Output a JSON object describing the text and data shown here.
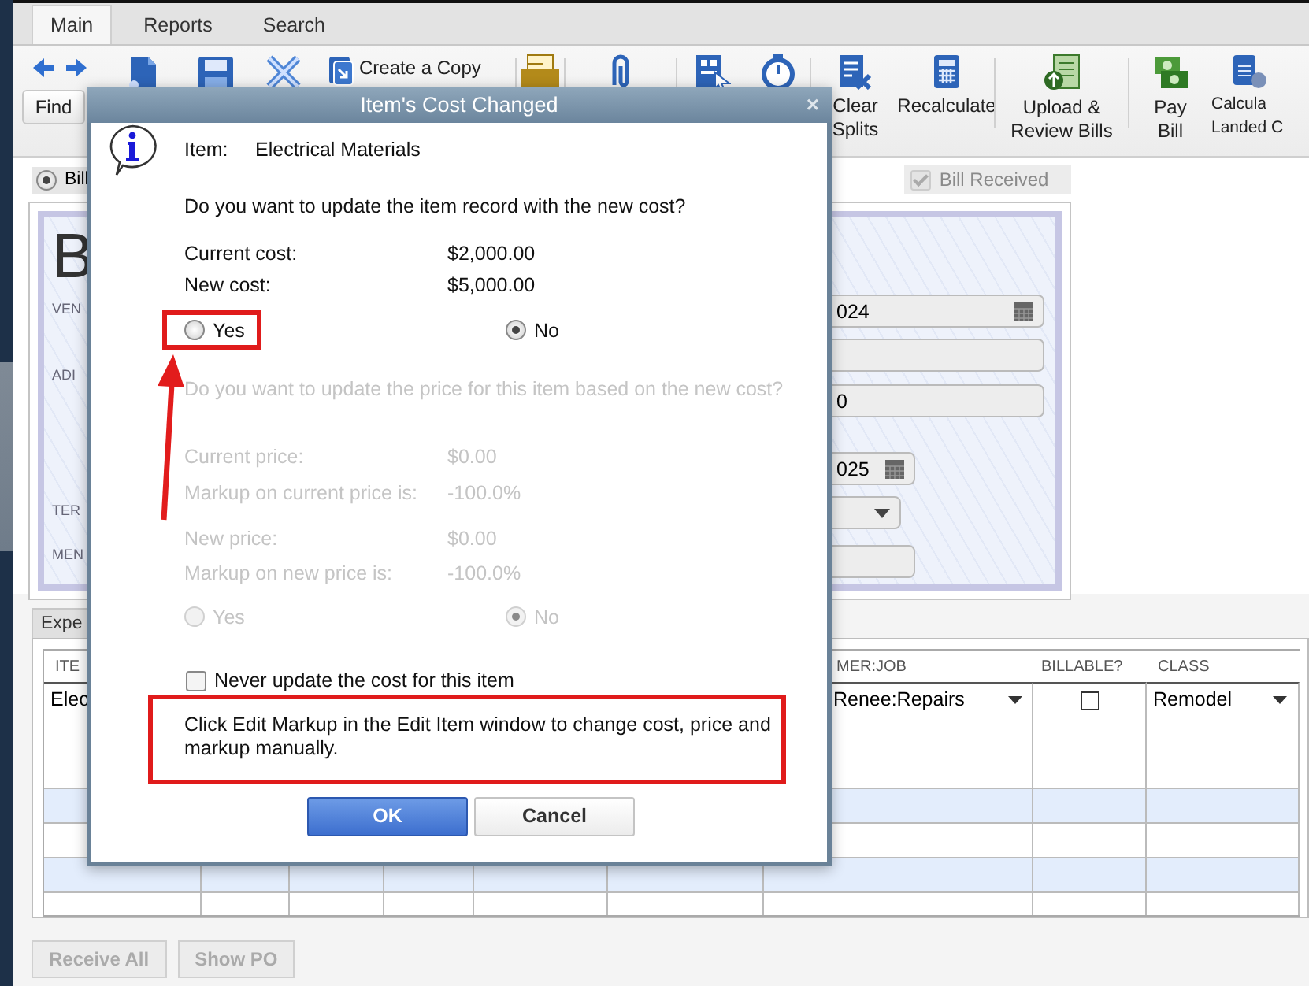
{
  "tabs": [
    {
      "label": "Main",
      "selected": true
    },
    {
      "label": "Reports",
      "selected": false
    },
    {
      "label": "Search",
      "selected": false
    }
  ],
  "toolbar": {
    "find": "Find",
    "create_copy": "Create a Copy",
    "buttons": [
      {
        "lines": [
          "Clear",
          "Splits"
        ]
      },
      {
        "lines": [
          "Recalculate"
        ]
      },
      {
        "lines": [
          "Upload &",
          "Review Bills"
        ]
      },
      {
        "lines": [
          "Pay",
          "Bill"
        ]
      },
      {
        "lines": [
          "Calcula",
          "Landed C"
        ]
      }
    ]
  },
  "form": {
    "bill_radio": {
      "label": "Bill",
      "selected": true
    },
    "bill_received": {
      "label": "Bill Received",
      "checked": true,
      "disabled": true
    },
    "title": "B",
    "labels": [
      "VEN",
      "ADI",
      "TER",
      "MEN"
    ],
    "fields": [
      {
        "kind": "date",
        "value": "024"
      },
      {
        "kind": "text"
      },
      {
        "kind": "text",
        "value": "0"
      },
      {
        "kind": "date",
        "value": "025"
      },
      {
        "kind": "dropdown"
      },
      {
        "kind": "text"
      }
    ]
  },
  "expenses_tab": "Expe",
  "table": {
    "columns": [
      "ITE",
      "MER:JOB",
      "BILLABLE?",
      "CLASS"
    ],
    "rows": [
      {
        "column_1": "Elec",
        "customer_job": "Renee:Repairs",
        "billable": false,
        "class": "Remodel"
      }
    ]
  },
  "bottom_buttons": [
    {
      "label": "Receive All",
      "disabled": true
    },
    {
      "label": "Show PO",
      "disabled": true
    }
  ],
  "dialog": {
    "title": "Item's Cost Changed",
    "close": "×",
    "item_label": "Item:",
    "item_value": "Electrical Materials",
    "cost_question": "Do you want to update the item record with the new cost?",
    "cost_rows": [
      {
        "label": "Current cost:",
        "value": "$2,000.00"
      },
      {
        "label": "New cost:",
        "value": "$5,000.00"
      }
    ],
    "cost_choice": [
      {
        "label": "Yes",
        "selected": false,
        "kind": "annotated"
      },
      {
        "label": "No",
        "selected": true,
        "kind": "plain"
      }
    ],
    "price_section": {
      "disabled": true,
      "question": "Do you want to update the price for this item based on the new cost?",
      "rows": [
        {
          "label": "Current price:",
          "value": "$0.00"
        },
        {
          "label": "Markup on current price is:",
          "value": "-100.0%"
        },
        {
          "label": "New price:",
          "value": "$0.00"
        },
        {
          "label": "Markup on new price is:",
          "value": "-100.0%"
        }
      ],
      "choice": [
        {
          "label": "Yes",
          "selected": false
        },
        {
          "label": "No",
          "selected": true
        }
      ]
    },
    "never_update": {
      "label": "Never update the cost for this item",
      "checked": false
    },
    "note": "Click Edit Markup in the Edit Item window to change cost, price and markup manually.",
    "note_highlighted": true,
    "buttons": [
      {
        "label": "OK",
        "kind": "primary"
      },
      {
        "label": "Cancel",
        "kind": "secondary"
      }
    ]
  }
}
